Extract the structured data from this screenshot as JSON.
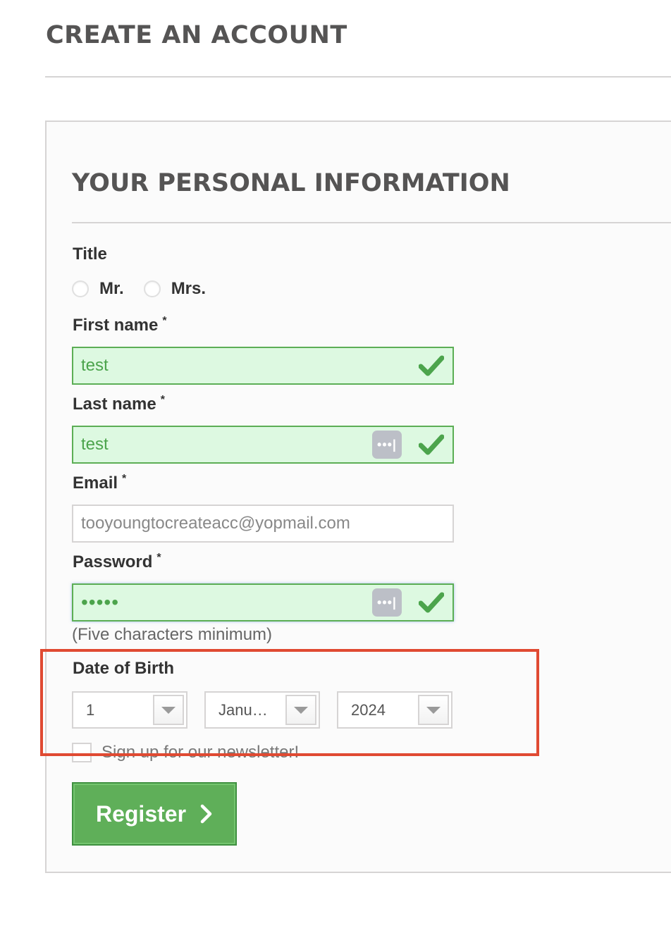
{
  "page": {
    "title": "CREATE AN ACCOUNT"
  },
  "section": {
    "title": "YOUR PERSONAL INFORMATION"
  },
  "title_field": {
    "label": "Title",
    "options": [
      {
        "label": "Mr.",
        "selected": false
      },
      {
        "label": "Mrs.",
        "selected": false
      }
    ]
  },
  "first_name": {
    "label": "First name",
    "required_mark": "*",
    "value": "test",
    "status": "valid"
  },
  "last_name": {
    "label": "Last name",
    "required_mark": "*",
    "value": "test",
    "status": "valid"
  },
  "email": {
    "label": "Email",
    "required_mark": "*",
    "value": "tooyoungtocreateacc@yopmail.com"
  },
  "password": {
    "label": "Password",
    "required_mark": "*",
    "value": "•••••",
    "status": "valid",
    "hint": "(Five characters minimum)"
  },
  "password_manager_key": {
    "glyph": "•••|"
  },
  "date_of_birth": {
    "label": "Date of Birth",
    "day": "1",
    "month": "Janu…",
    "year": "2024"
  },
  "newsletter": {
    "label": "Sign up for our newsletter!",
    "checked": false
  },
  "register_button": {
    "label": "Register"
  },
  "colors": {
    "valid_green": "#5cae55",
    "valid_bg": "#ddf9e1",
    "button_green": "#5faf59",
    "highlight_red": "#e04a32"
  },
  "icons": [
    "check-icon",
    "password-key-icon",
    "dropdown-arrow-icon",
    "chevron-right-icon"
  ]
}
